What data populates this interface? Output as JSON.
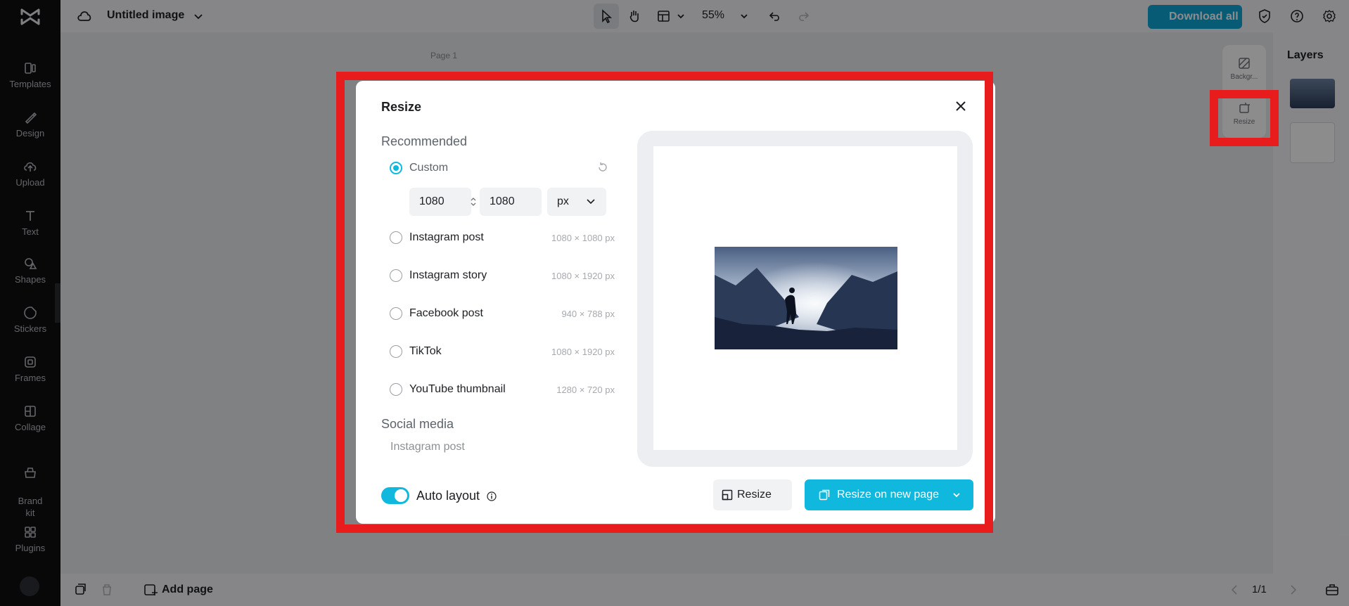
{
  "sidebar": {
    "items": [
      {
        "label": "Templates",
        "icon": "templates-icon"
      },
      {
        "label": "Design",
        "icon": "design-icon"
      },
      {
        "label": "Upload",
        "icon": "upload-icon"
      },
      {
        "label": "Text",
        "icon": "text-icon"
      },
      {
        "label": "Shapes",
        "icon": "shapes-icon"
      },
      {
        "label": "Stickers",
        "icon": "stickers-icon"
      },
      {
        "label": "Frames",
        "icon": "frames-icon"
      },
      {
        "label": "Collage",
        "icon": "collage-icon"
      },
      {
        "label": "Brand\nkit",
        "icon": "brand-kit-icon"
      },
      {
        "label": "Plugins",
        "icon": "plugins-icon"
      }
    ]
  },
  "topbar": {
    "title": "Untitled image",
    "zoom": "55%",
    "download_label": "Download all"
  },
  "canvas": {
    "page_label": "Page 1"
  },
  "bottombar": {
    "add_page_label": "Add page",
    "page_count": "1/1"
  },
  "rightpanel": {
    "layers_title": "Layers",
    "float_items": [
      {
        "label": "Backgr...",
        "icon": "background-icon"
      },
      {
        "label": "Resize",
        "icon": "resize-icon"
      }
    ]
  },
  "modal": {
    "title": "Resize",
    "recommended_label": "Recommended",
    "custom_label": "Custom",
    "width_value": "1080",
    "height_value": "1080",
    "unit": "px",
    "presets": [
      {
        "label": "Instagram post",
        "size": "1080 × 1080 px"
      },
      {
        "label": "Instagram story",
        "size": "1080 × 1920 px"
      },
      {
        "label": "Facebook post",
        "size": "940 × 788 px"
      },
      {
        "label": "TikTok",
        "size": "1080 × 1920 px"
      },
      {
        "label": "YouTube thumbnail",
        "size": "1280 × 720 px"
      }
    ],
    "social_media_label": "Social media",
    "social_first_item": "Instagram post",
    "auto_layout_label": "Auto layout",
    "auto_layout_on": true,
    "resize_button": "Resize",
    "resize_new_page_button": "Resize on new page"
  },
  "colors": {
    "accent": "#11b8de",
    "highlight": "#e81c1c",
    "sidebar_bg": "#0f1012"
  }
}
